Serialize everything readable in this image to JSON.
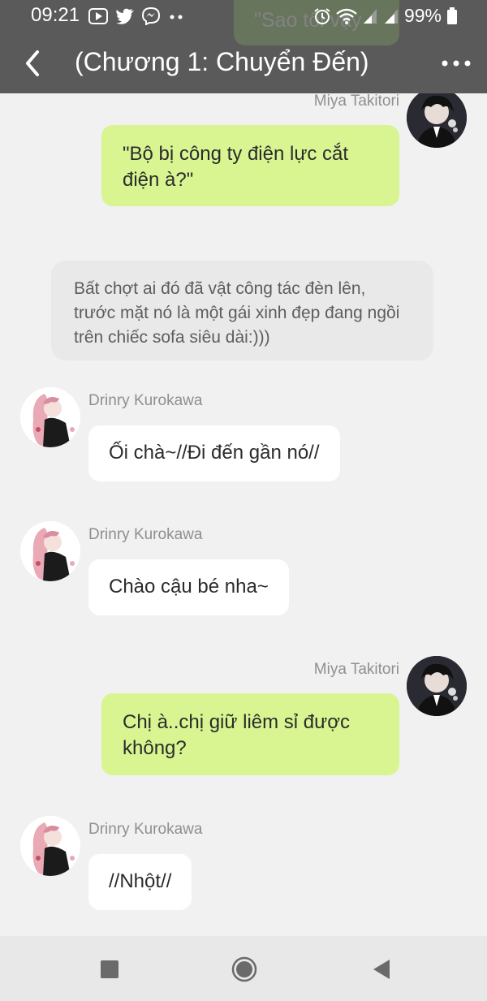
{
  "status_bar": {
    "time": "09:21",
    "battery": "99%",
    "app_icons": [
      "youtube-icon",
      "twitter-icon",
      "messenger-icon",
      "more-dots-icon"
    ]
  },
  "ghost_bubble_text": "\"Sao tôi vậy",
  "header": {
    "title": "(Chương 1: Chuyển Đến)"
  },
  "messages": [
    {
      "sender": "Miya Takitori",
      "text": "\"Bộ bị công ty điện lực cắt điện à?\"",
      "side": "right"
    },
    {
      "narration": "Bất chợt ai đó đã vật công tác đèn lên, trước mặt nó là một gái xinh đẹp đang ngồi trên chiếc sofa siêu dài:)))"
    },
    {
      "sender": "Drinry Kurokawa",
      "text": "Ối chà~//Đi đến gần nó//",
      "side": "left"
    },
    {
      "sender": "Drinry Kurokawa",
      "text": "Chào cậu bé nha~",
      "side": "left"
    },
    {
      "sender": "Miya Takitori",
      "text": "Chị à..chị giữ liêm sỉ được không?",
      "side": "right"
    },
    {
      "sender": "Drinry Kurokawa",
      "text": "//Nhột//",
      "side": "left"
    }
  ],
  "colors": {
    "header_bg": "#5a5a5a",
    "outgoing_bubble": "#d8f592",
    "incoming_bubble": "#ffffff",
    "narration_bg": "#e9e9e9",
    "chat_bg": "#f1f1f1"
  }
}
